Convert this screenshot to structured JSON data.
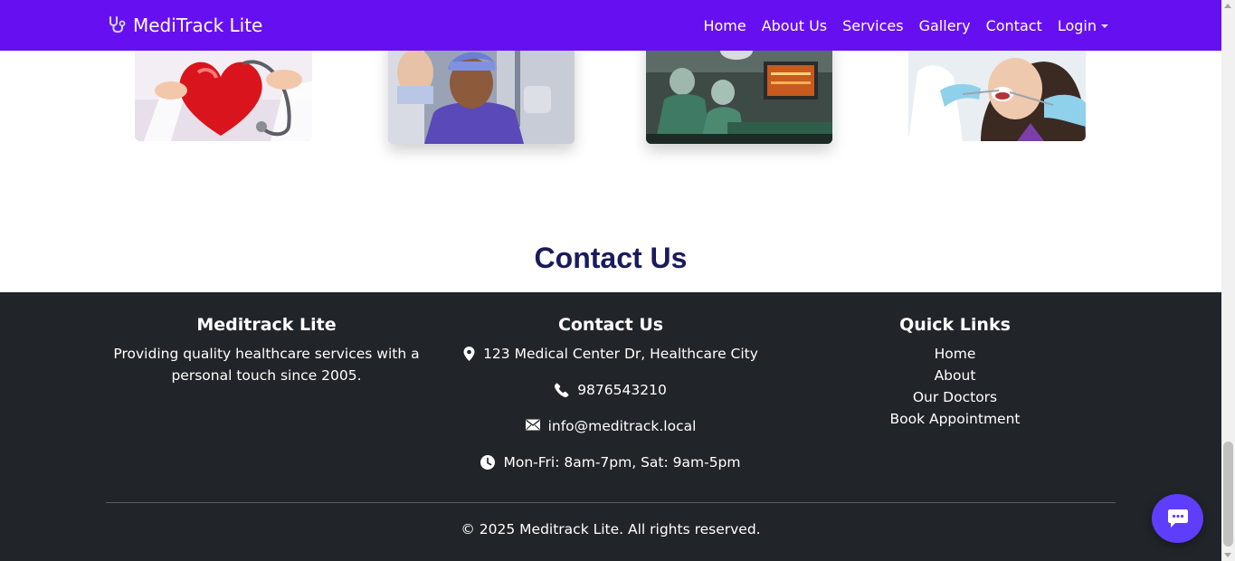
{
  "navbar": {
    "brand": "MediTrack Lite",
    "brand_icon": "stethoscope-icon",
    "bg_color": "#6610f2",
    "links": [
      "Home",
      "About Us",
      "Services",
      "Gallery",
      "Contact",
      "Login"
    ]
  },
  "gallery": {
    "images": [
      "heart-stethoscope-photo",
      "doctor-in-scrubs-photo",
      "operating-room-photo",
      "dental-checkup-photo"
    ]
  },
  "contact_section": {
    "title": "Contact Us"
  },
  "footer": {
    "about": {
      "title": "Meditrack Lite",
      "line1": "Providing quality healthcare services with a",
      "line2": "personal touch since 2005."
    },
    "contact": {
      "title": "Contact Us",
      "address": "123 Medical Center Dr, Healthcare City",
      "phone": "9876543210",
      "email": "info@meditrack.local",
      "hours": "Mon-Fri: 8am-7pm, Sat: 9am-5pm"
    },
    "quick_links": {
      "title": "Quick Links",
      "items": [
        "Home",
        "About",
        "Our Doctors",
        "Book Appointment"
      ]
    },
    "copyright": "© 2025 Meditrack Lite. All rights reserved.",
    "bg_color": "#212529"
  },
  "chat_button": {
    "icon": "chat-bubble-icon",
    "color": "#5f3dfc"
  }
}
